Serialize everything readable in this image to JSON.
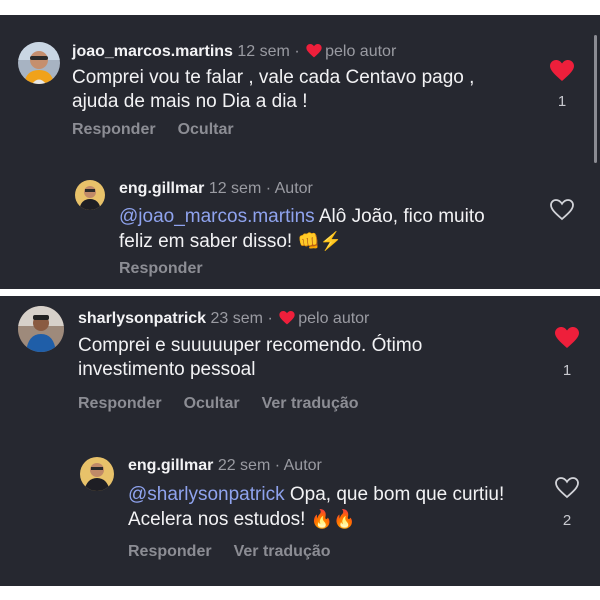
{
  "comments": [
    {
      "username": "joao_marcos.martins",
      "time": "12 sem",
      "separator": "·",
      "author_like": "pelo autor",
      "text": "Comprei vou te falar , vale cada Centavo pago , ajuda de mais no Dia a dia !",
      "actions": [
        "Responder",
        "Ocultar"
      ],
      "like_count": "1",
      "liked": true,
      "reply": {
        "username": "eng.gillmar",
        "time": "12 sem",
        "separator": "·",
        "author_tag": "Autor",
        "mention": "@joao_marcos.martins",
        "text": " Alô João, fico muito feliz em saber disso! ",
        "emojis": [
          "👊",
          "⚡"
        ],
        "actions": [
          "Responder"
        ],
        "like_count": ""
      }
    },
    {
      "username": "sharlysonpatrick",
      "time": "23 sem",
      "separator": "·",
      "author_like": "pelo autor",
      "text": "Comprei e suuuuuper recomendo. Ótimo investimento pessoal",
      "actions": [
        "Responder",
        "Ocultar",
        "Ver tradução"
      ],
      "like_count": "1",
      "liked": true,
      "reply": {
        "username": "eng.gillmar",
        "time": "22 sem",
        "separator": "·",
        "author_tag": "Autor",
        "mention": "@sharlysonpatrick",
        "text": " Opa, que bom que curtiu! Acelera nos estudos! ",
        "emojis": [
          "🔥",
          "🔥"
        ],
        "actions": [
          "Responder",
          "Ver tradução"
        ],
        "like_count": "2"
      }
    }
  ],
  "colors": {
    "background": "#262830",
    "mention": "#8fa3ee",
    "like_red": "#ee1f3b",
    "muted": "#9a9ba2"
  },
  "icons": {
    "like_filled": "heart-filled-icon",
    "like_outline": "heart-outline-icon"
  }
}
